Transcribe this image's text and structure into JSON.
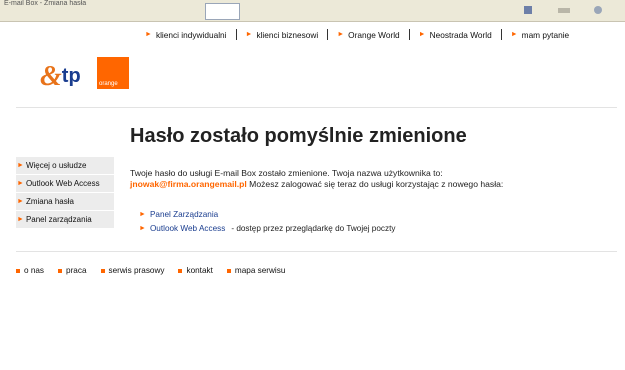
{
  "browser": {
    "window_title": "E-mail Box - Zmiana hasła"
  },
  "top_nav": {
    "items": [
      "klienci indywidualni",
      "klienci biznesowi",
      "Orange World",
      "Neostrada World",
      "mam pytanie"
    ]
  },
  "logos": {
    "tp_text": "tp",
    "orange_text": "orange"
  },
  "sidebar": {
    "items": [
      "Więcej o usłudze",
      "Outlook Web Access",
      "Zmiana hasła",
      "Panel zarządzania"
    ]
  },
  "main": {
    "title": "Hasło zostało pomyślnie zmienione",
    "message_line1": "Twoje hasło do usługi E-mail Box zostało zmienione. Twoja nazwa użytkownika to:",
    "username": "jnowak@firma.orangemail.pl",
    "message_line2": " Możesz zalogować się teraz do usługi korzystając z nowego hasła:",
    "links": [
      {
        "label": "Panel Zarządzania",
        "desc": ""
      },
      {
        "label": "Outlook Web Access",
        "desc": "- dostęp przez przeglądarkę do Twojej poczty"
      }
    ]
  },
  "footer": {
    "items": [
      "o nas",
      "praca",
      "serwis prasowy",
      "kontakt",
      "mapa serwisu"
    ]
  },
  "colors": {
    "accent": "#ff6600",
    "link": "#1a3d8f",
    "sidebar_bg": "#ececec"
  }
}
